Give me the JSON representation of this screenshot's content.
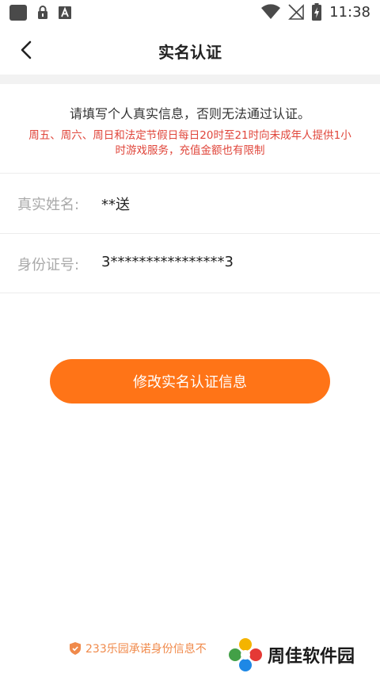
{
  "status_bar": {
    "time": "11:38",
    "icons": [
      "notification-square-icon",
      "lock-icon",
      "a-icon",
      "wifi-icon",
      "no-signal-icon",
      "battery-charging-icon"
    ]
  },
  "header": {
    "title": "实名认证",
    "back_icon": "chevron-left-icon"
  },
  "notice": {
    "main": "请填写个人真实信息，否则无法通过认证。",
    "warning": "周五、周六、周日和法定节假日每日20时至21时向未成年人提供1小时游戏服务，充值金额也有限制"
  },
  "fields": {
    "name_label": "真实姓名:",
    "name_value": "**送",
    "id_label": "身份证号:",
    "id_value": "3****************3"
  },
  "actions": {
    "modify_label": "修改实名认证信息"
  },
  "footer": {
    "promise_text": "233乐园承诺身份信息不",
    "watermark_text": "周佳软件园"
  },
  "colors": {
    "accent": "#ff7417",
    "warning": "#e0463b",
    "footer_text": "#f08a4b"
  }
}
